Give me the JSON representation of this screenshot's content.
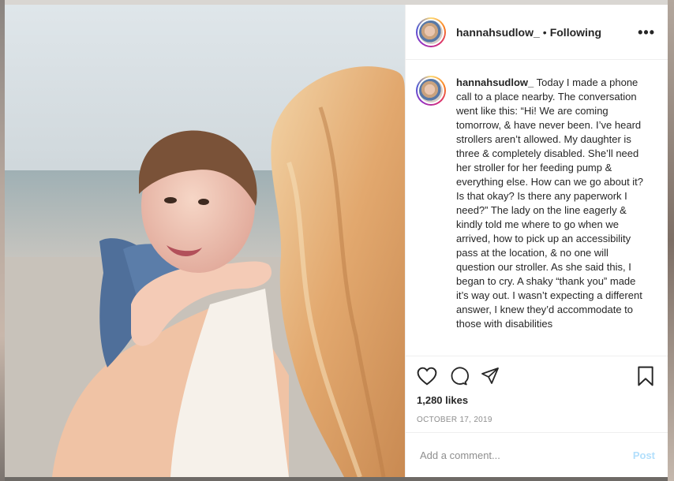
{
  "post": {
    "username": "hannahsudlow_",
    "separator": "•",
    "follow_status": "Following",
    "more_label": "•••",
    "image_alt": "Woman with long blonde hair holding a smiling toddler on the beach",
    "caption_user": "hannahsudlow_",
    "caption_text": "Today I made a phone call to a place nearby. The conversation went like this: “Hi! We are coming tomorrow, & have never been. I’ve heard strollers aren’t allowed. My daughter is three & completely disabled. She’ll need her stroller for her feeding pump & everything else. How can we go about it? Is that okay? Is there any paperwork I need?” The lady on the line eagerly & kindly told me where to go when we arrived, how to pick up an accessibility pass at the location, & no one will question our stroller. As she said this, I began to cry. A shaky “thank you” made it’s way out. I wasn’t expecting a different answer, I knew they’d accommodate to those with disabilities",
    "likes": "1,280 likes",
    "date": "OCTOBER 17, 2019"
  },
  "comment": {
    "placeholder": "Add a comment...",
    "post_label": "Post"
  },
  "icons": [
    "heart-icon",
    "comment-icon",
    "share-icon",
    "bookmark-icon",
    "more-icon"
  ],
  "colors": {
    "text": "#262626",
    "muted": "#8e8e8e",
    "post_button": "#b2dffc",
    "divider": "#efefef"
  }
}
